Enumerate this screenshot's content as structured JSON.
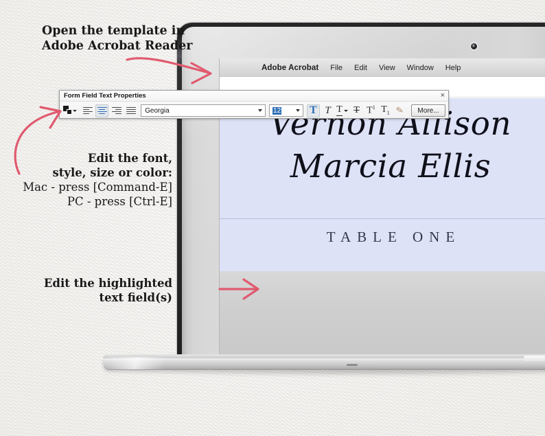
{
  "annotations": {
    "open_template": {
      "line1": "Open the template in",
      "line2": "Adobe Acrobat Reader"
    },
    "edit_font": {
      "line1": "Edit the font,",
      "line2": "style, size or color:",
      "line3": "Mac - press [Command-E]",
      "line4": "PC - press [Ctrl-E]"
    },
    "edit_fields": {
      "line1": "Edit the highlighted",
      "line2": "text field(s)"
    },
    "arrow_color": "#e05a6e"
  },
  "laptop": {
    "menubar": {
      "app_name": "Adobe Acrobat",
      "items": [
        "File",
        "Edit",
        "View",
        "Window",
        "Help"
      ]
    },
    "screen": {
      "card": {
        "name_line_1": "Vernon Allison",
        "name_line_2": "Marcia Ellis",
        "table_label": "TABLE ONE",
        "background_color": "#dde2f7",
        "text_color": "#10101a"
      }
    }
  },
  "dialog": {
    "title": "Form Field Text Properties",
    "close_label": "×",
    "font": {
      "value": "Georgia",
      "placeholder": "Georgia"
    },
    "size": {
      "value": "12",
      "placeholder": "12",
      "selected": true,
      "highlight_color": "#2f6fb5"
    },
    "buttons": {
      "text_color": "text-color",
      "align_left": "Align Left",
      "align_center": "Align Center",
      "align_right": "Align Right",
      "align_justify": "Justify",
      "bold": "T",
      "italic": "T",
      "underline": "T",
      "strikethrough": "T",
      "superscript": "T",
      "superscript_mark": "1",
      "subscript": "T",
      "subscript_mark": "1",
      "pen": "✎",
      "more": "More..."
    },
    "active_align": "center",
    "active_style": "bold",
    "accent_color": "#2f6fb5"
  },
  "colors": {
    "paper_background": "#f8f7f5",
    "laptop_bezel": "#d4d4d4",
    "laptop_edge": "#26262a",
    "card_lavender": "#dde2f7"
  }
}
